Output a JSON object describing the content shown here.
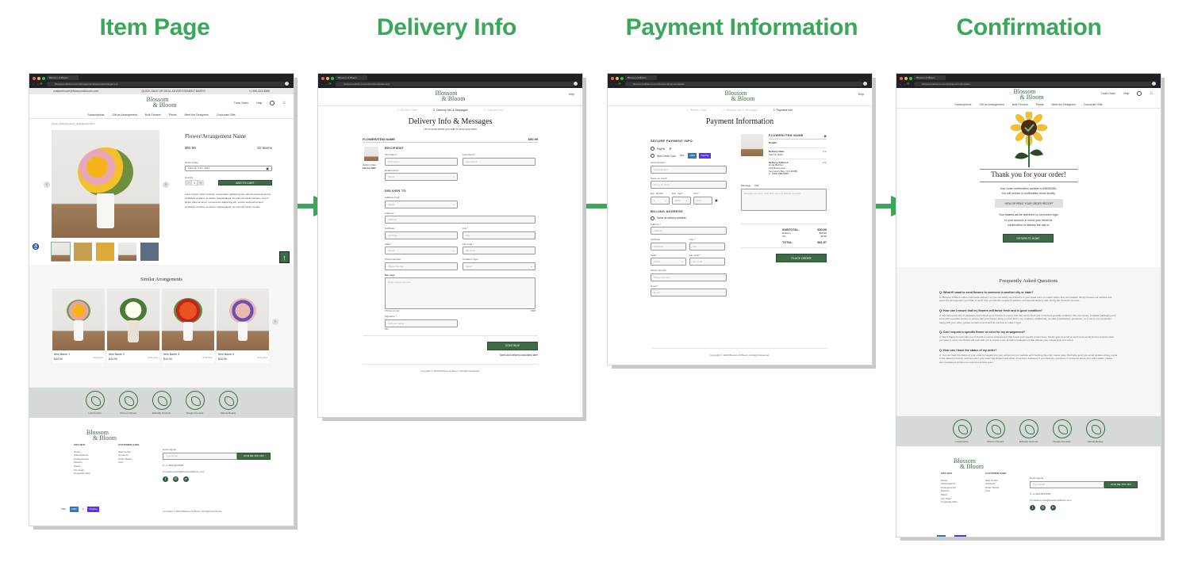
{
  "stages": [
    {
      "title": "Item Page"
    },
    {
      "title": "Delivery Info"
    },
    {
      "title": "Payment Information"
    },
    {
      "title": "Confirmation"
    }
  ],
  "colors": {
    "stage_title": "#3aa75a",
    "brand_green": "#3d6b45",
    "arrow": "#3aa75a",
    "values_bar": "#d6dad6"
  },
  "browser": {
    "tab_title": "Blossom & Bloom",
    "urls": [
      "blossomandbloom.com/arrangements/selectedarrangement",
      "blossomandbloom.com/checkout/addresses",
      "blossomandbloom.com/checkout/paymentdetails",
      "blossomandbloom.com/checkout/confirmation"
    ]
  },
  "brand": {
    "line1": "Blossom",
    "line2": "& Bloom"
  },
  "promo_bar": {
    "email": "customercare@blossom&bloom.com",
    "message": "QUICK SALE OR DEAL ADVERTISEMENT BAR!!!!!",
    "phone": "+1 999-333-5555"
  },
  "header": {
    "track_order": "Track Order",
    "help": "Help",
    "cart_count": "0"
  },
  "nav": [
    "Subscriptions",
    "Gift an Arrangement",
    "Bulk Flowers",
    "Plants",
    "Meet the Designers",
    "Corporate Gifts"
  ],
  "item_page": {
    "breadcrumb": "home / arrangements / arrangement item",
    "product_name": "Flower/Arrangement Name",
    "price": "$50.99",
    "stems": "20 Stems",
    "delivery_date_label": "Delivery Date",
    "delivery_date_value": "February 14th, 2023",
    "quantity_label": "Quantity",
    "quantity_value": "1",
    "minus": "-",
    "plus": "+",
    "add_to_cart": "ADD TO CART",
    "description": "Lorem ipsum dolor sit amet, consectetur adipiscing elit, sed do eiusmod tempor incididunt ut labore et dolore magna aliqua. Ut enim ad minim veniam. Lorem ipsum dolor sit amet, consectetur adipiscing elit, sed do eiusmod tempor incididunt ut labore et dolore magna aliqua. Ut enim ad minim veniam.",
    "similar_title": "Similar Arrangements",
    "similar_items": [
      {
        "name": "Item Name 1",
        "price": "$44.99",
        "stems": "20-24 stems"
      },
      {
        "name": "Item Name 2",
        "price": "$44.99",
        "stems": "20-24 stems"
      },
      {
        "name": "Item Name 3",
        "price": "$44.99",
        "stems": "20-24 stems"
      },
      {
        "name": "Item Name 4",
        "price": "$44.99",
        "stems": "20-24 stems"
      }
    ]
  },
  "values": [
    "Local Farms",
    "Women Owned",
    "Ethically Sourced",
    "People Focused",
    "Natural Beauty"
  ],
  "footer": {
    "sitemap_title": "SITE MAP",
    "sitemap": [
      "Home",
      "Subscriptions",
      "Arrangements",
      "Flowers",
      "Plants",
      "Our Team",
      "Corporate Gifts"
    ],
    "care_title": "CUSTOMER CARE",
    "care": [
      "Help Center",
      "Accounts",
      "Order Status",
      "Cart"
    ],
    "signup_label": "Email signup",
    "signup_placeholder": "Type Email",
    "signup_button": "GIVE ME 15% OFF",
    "phone": "+1 999-333-5555",
    "email": "customercare@blossom&bloom.com",
    "social": [
      "f",
      "◎",
      "P"
    ],
    "cards": [
      "VISA",
      "AMEX",
      "P",
      "ShopPay"
    ],
    "copyright": "Copyright © 2023 Blossom & Bloom. All Right Reserved."
  },
  "checkout_steps": [
    "1. Review Order",
    "2. Delivery Info & Messages",
    "3. Payment Info"
  ],
  "delivery": {
    "title": "Delivery Info & Messages",
    "subtitle": "Let us know where you want to send your order",
    "item_name": "FLOWER/ITEM NAME",
    "item_price": "$50.99",
    "delivery_date_label": "Delivery Date",
    "delivery_date": "Feb 14, 2023",
    "recipient_h": "RECIPIENT",
    "first_name_label": "First Name*",
    "first_name_ph": "First Name",
    "last_name_label": "Last Name*",
    "last_name_ph": "Last Name",
    "relationship_label": "Relationship*",
    "relationship_ph": "Select",
    "deliver_to_h": "DELIVER TO",
    "address_type_label": "Address Type*",
    "address_type_ph": "Select",
    "address_label": "Address *",
    "address_ph": "Address",
    "apt_label": "Apt/Suite",
    "apt_ph": "Apt/Suite",
    "city_label": "City *",
    "city_ph": "City",
    "state_label": "State*",
    "state_ph": "Select",
    "zip_label": "Zip Code *",
    "zip_ph": "Zip Code",
    "phone_label": "Phone Number",
    "phone_ph": "Phone Number",
    "occasion_label": "Occasion Type",
    "occasion_ph": "Select",
    "message_label": "Message",
    "message_ph": "Write a personal note",
    "message_hint": "170 lines on card",
    "message_count": "0/396",
    "signature_label": "Signature *",
    "signature_ph": "Add your name",
    "signature_count": "0/44",
    "continue": "CONTINUE",
    "taxes_note": "Taxes and delivery calculated later"
  },
  "payment": {
    "title": "Payment Information",
    "secure_h": "SECURE PAYMENT INFO",
    "paypal": "PayPal",
    "new_card": "New Credit Card",
    "card_number_label": "Card Number*",
    "card_number_ph": "Card Number",
    "name_label": "Name on Card*",
    "name_ph": "Name on Card",
    "exp_month_label": "Exp. Month*",
    "exp_month_val": "1",
    "exp_year_label": "Exp. Year*",
    "exp_year_val": "2023",
    "cvv_label": "CVV*",
    "cvv_ph": "CVV",
    "billing_h": "BILLING ADDRESS",
    "same_as": "Same as delivery address",
    "address_label": "Address *",
    "address_ph": "Address",
    "apt_label": "Apt/Suite",
    "apt_ph": "Apt/Suite",
    "city_label": "City *",
    "city_ph": "City",
    "state_label": "State*",
    "state_ph": "Select",
    "zip_label": "Zip Code *",
    "zip_ph": "Zip Code",
    "phone_label": "Phone Number",
    "phone_ph": "Phone Number",
    "email_label": "Email *",
    "email_ph": "Email",
    "summary_item": "FLOWER/ITEM NAME",
    "details": "Details:",
    "delivery_date_label": "Delivery Date:",
    "delivery_date": "Feb 14, 2023",
    "delivery_address_label": "Delivery Address:",
    "address_lines": [
      "Linda Belcher",
      "123 Ocean Ave.",
      "Seymour's Bay, NJ 123456",
      "1 - (000) 888-5555"
    ],
    "edit": "Edit",
    "message_label": "Message",
    "message_note": "Message left blank. Click 'Edit' above to change message.",
    "subtotal_label": "SUBTOTAL:",
    "subtotal": "$50.99",
    "delivery_label": "Delivery",
    "delivery_fee": "$25.00",
    "tax_label": "Tax",
    "tax": "$5.58",
    "total_label": "TOTAL:",
    "total": "$81.57",
    "place_order": "PLACE ORDER"
  },
  "confirmation": {
    "thank_you": "Thank you for your order!",
    "line1": "Your order confirmation number is #98493482.",
    "line2": "You will receive a confirmation email shortly.",
    "receipt_button": "VIEW OR PRINT YOUR ORDER RECEIPT",
    "delivery_note1": "Your flowers will be delivered on xx/xx/xxxx login",
    "delivery_note2": "to your account or check your email for",
    "delivery_note3": "confirmation of delivery the day of.",
    "home_button": "RETURN TO HOME",
    "faq_title": "Frequently Asked Questions",
    "faqs": [
      {
        "q": "Q: What if I want to send flowers to someone in another city or state?",
        "a": "A: Blossom & Bloom offers nationwide delivery, so you can easily send flowers to your loved ones no matter where they are located. Simply browse our website and select the arrangement you'd like to send, then provide the recipient's address and desired delivery date during the checkout process."
      },
      {
        "q": "Q: How can I ensure that my flowers will arrive fresh and in good condition?",
        "a": "A: We take great care in packaging and shipping our flowers to ensure that they arrive fresh and in the best possible condition. We use secure, insulated packaging and work with reputable carriers to ensure that your flowers arrive on time and in top condition. Additionally, we offer a satisfaction guarantee, so if you're not completely happy with your order, please contact us and we'll do our best to make it right."
      },
      {
        "q": "Q: Can I request a specific flower or color for my arrangement?",
        "a": "A: We're happy to work with you to create a custom arrangement that meets your specific preferences. Simply give us a call or send us an email and let us know what you have in mind. Our florists will work with you to create a one-of-a-kind arrangement that reflects your unique style and vision."
      },
      {
        "q": "Q: How can I track the status of my order?",
        "a": "A: You can track the status of your order by logging into your account on our website and checking the order status page. We'll also send you email updates at key points in the delivery process, such as when your order has shipped and when it has been delivered. If you have any questions or concerns about your order status, please don't hesitate to contact our customer service team."
      }
    ]
  }
}
